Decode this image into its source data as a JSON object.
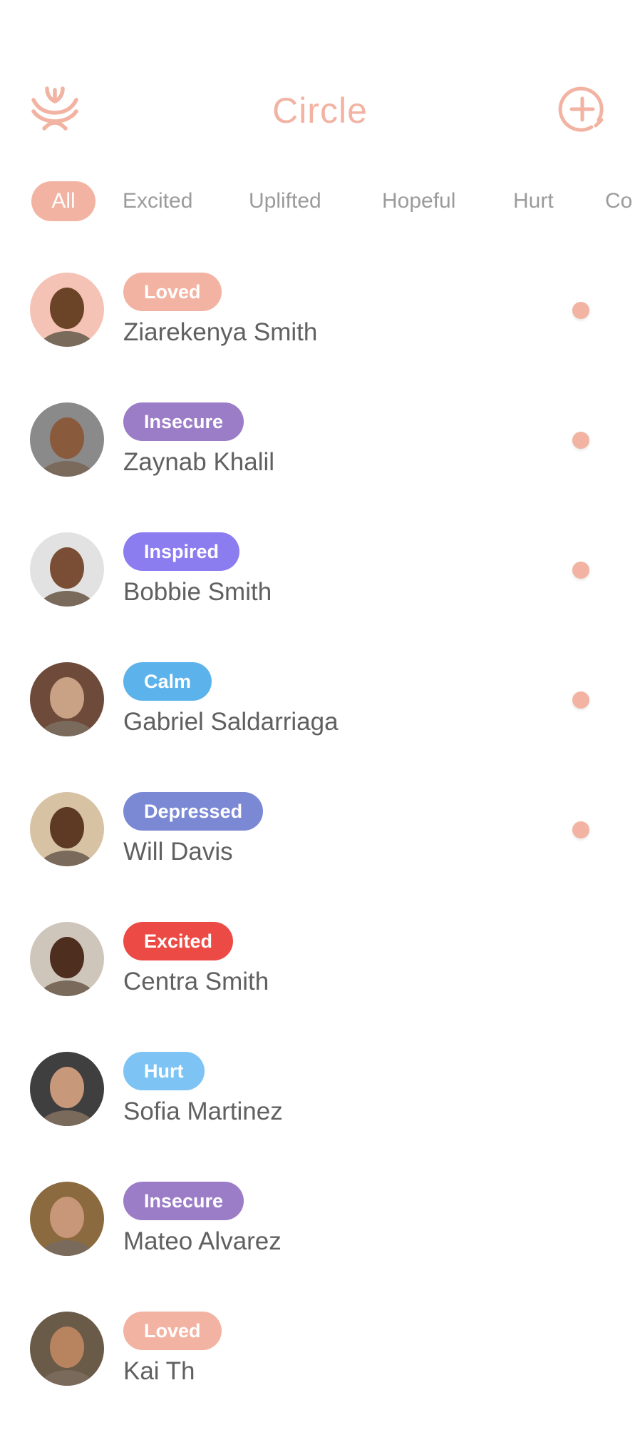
{
  "header": {
    "title": "Circle",
    "logo_icon": "lotus-logo-icon",
    "add_icon": "add-circle-icon"
  },
  "colors": {
    "accent": "#f2b3a2",
    "muted_text": "#9b9b9b",
    "name_text": "#606060"
  },
  "filters": {
    "items": [
      "All",
      "Excited",
      "Uplifted",
      "Hopeful",
      "Hurt",
      "Co"
    ],
    "selected": "All"
  },
  "contacts": [
    {
      "name": "Ziarekenya Smith",
      "mood": "Loved",
      "mood_color": "#f2b3a2",
      "unread": true,
      "skin": "#6b4428",
      "bg": "#f4c3b5"
    },
    {
      "name": "Zaynab Khalil",
      "mood": "Insecure",
      "mood_color": "#9b7cc6",
      "unread": true,
      "skin": "#8a5a3c",
      "bg": "#8a8a8a"
    },
    {
      "name": "Bobbie Smith",
      "mood": "Inspired",
      "mood_color": "#8b7cf0",
      "unread": true,
      "skin": "#7a4e34",
      "bg": "#e2e2e2"
    },
    {
      "name": "Gabriel Saldarriaga",
      "mood": "Calm",
      "mood_color": "#5cb2ea",
      "unread": true,
      "skin": "#c9a184",
      "bg": "#6e4a3a"
    },
    {
      "name": "Will Davis",
      "mood": "Depressed",
      "mood_color": "#7b88d4",
      "unread": true,
      "skin": "#5e3a24",
      "bg": "#d7c2a4"
    },
    {
      "name": "Centra Smith",
      "mood": "Excited",
      "mood_color": "#ec4b45",
      "unread": false,
      "skin": "#4e2e1e",
      "bg": "#cfc6bb"
    },
    {
      "name": "Sofia Martinez",
      "mood": "Hurt",
      "mood_color": "#7dc4f4",
      "unread": false,
      "skin": "#c8987a",
      "bg": "#3f3f3f"
    },
    {
      "name": "Mateo Alvarez",
      "mood": "Insecure",
      "mood_color": "#9b7cc6",
      "unread": false,
      "skin": "#c89678",
      "bg": "#8a6a3e"
    },
    {
      "name": "Kai Th",
      "mood": "Loved",
      "mood_color": "#f2b3a2",
      "unread": false,
      "skin": "#b88460",
      "bg": "#6a5a48"
    }
  ]
}
